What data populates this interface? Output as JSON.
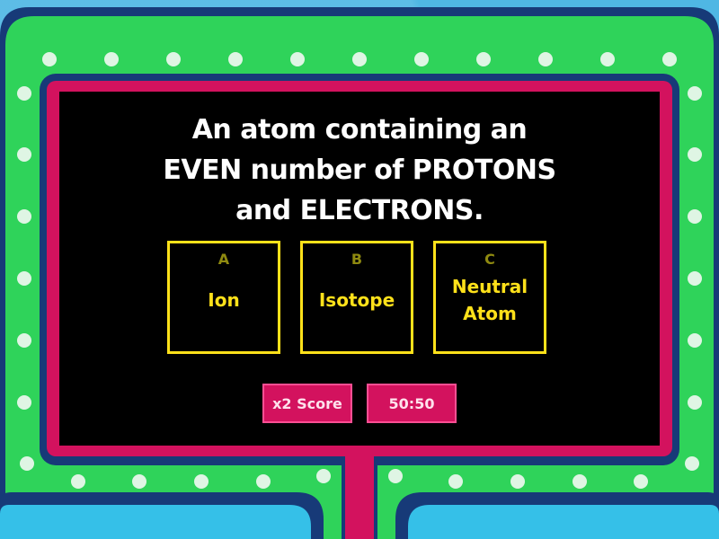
{
  "game": {
    "question_lines": [
      "An atom containing an",
      "EVEN number of PROTONS",
      "and ELECTRONS."
    ],
    "answers": [
      {
        "letter": "A",
        "text": "Ion"
      },
      {
        "letter": "B",
        "text": "Isotope"
      },
      {
        "letter": "C",
        "text": "Neutral\nAtom"
      }
    ],
    "powerups": {
      "double_score_label": "x2 Score",
      "fifty_fifty_label": "50:50"
    }
  },
  "colors": {
    "frame_green": "#2fd35a",
    "frame_navy": "#173a78",
    "screen_border": "#d3125e",
    "screen_bg": "#000000",
    "answer_yellow": "#ffe11a",
    "sky_blue": "#4fb7e4"
  }
}
